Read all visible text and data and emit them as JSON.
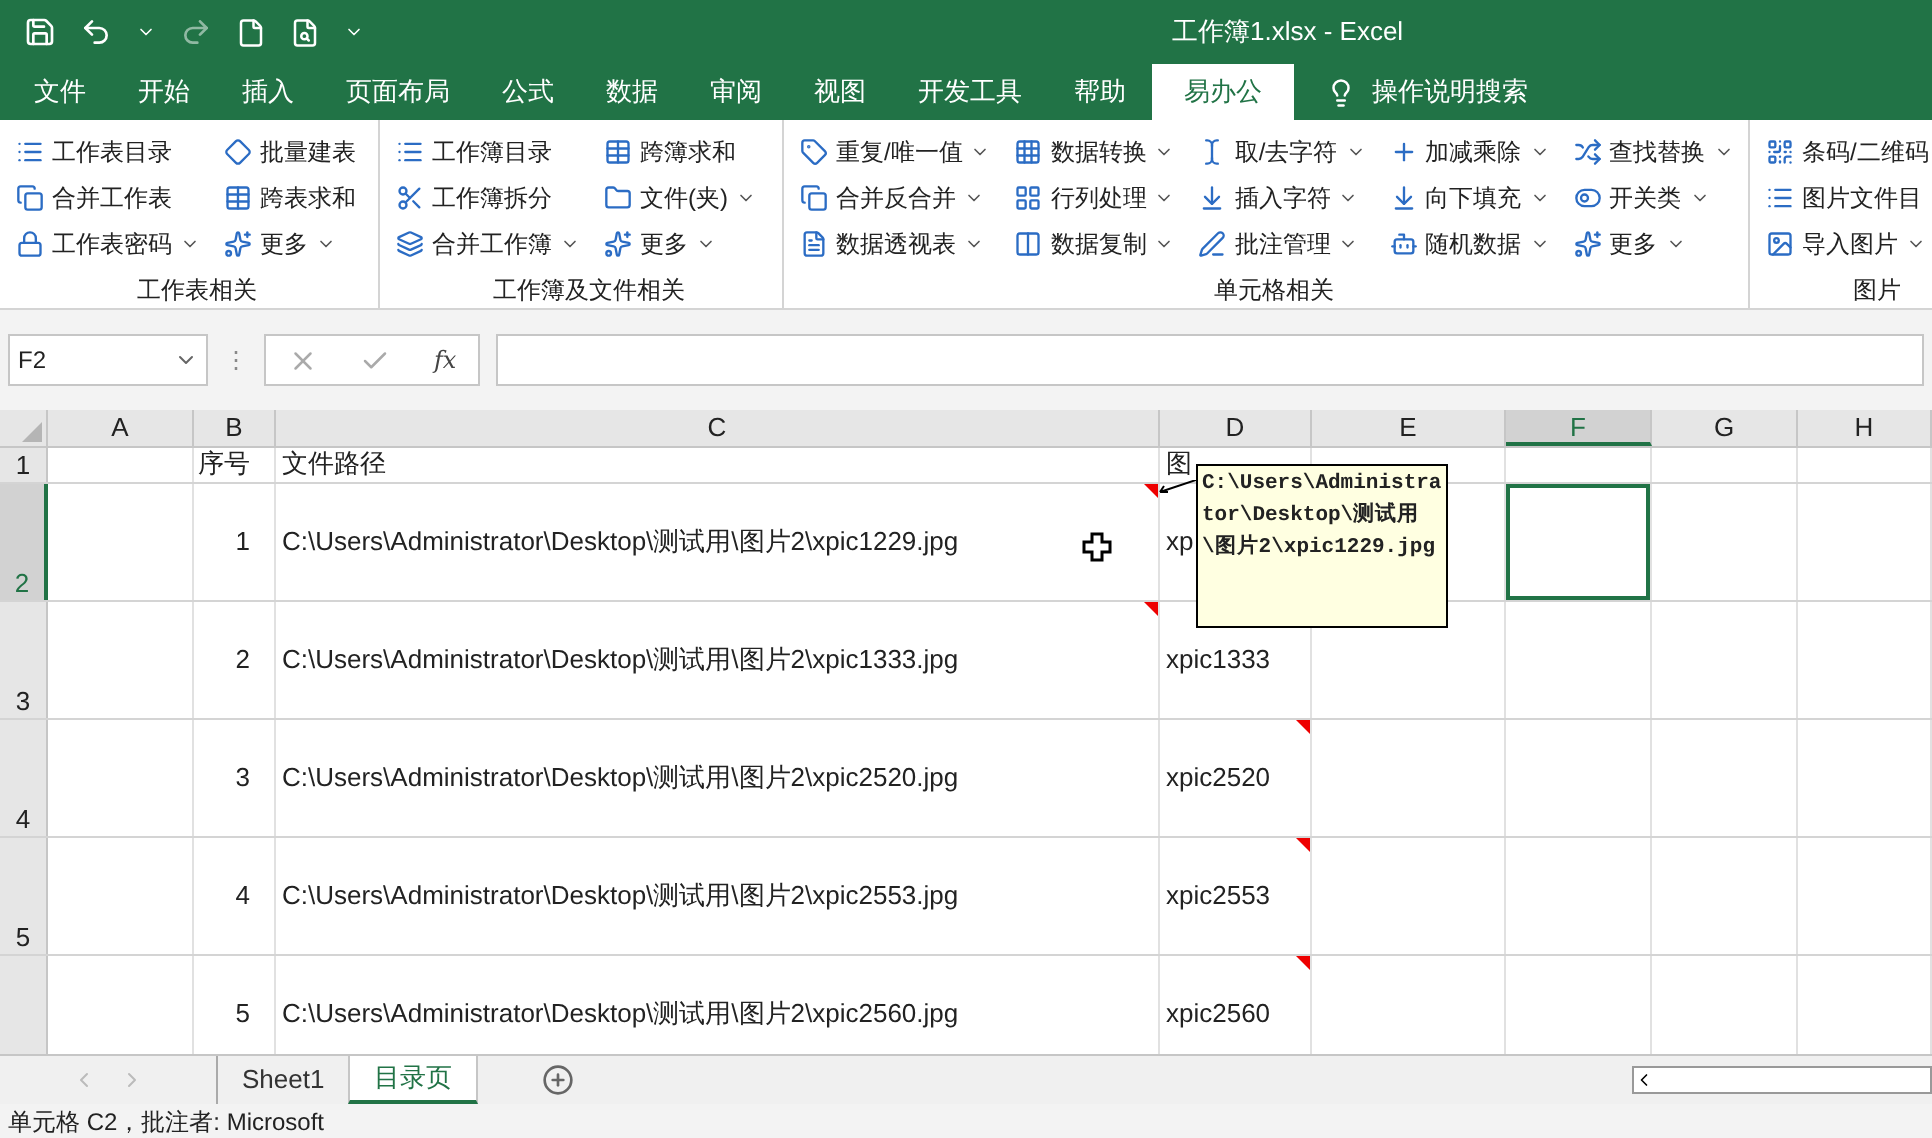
{
  "title_bar": {
    "title": "工作簿1.xlsx  -  Excel"
  },
  "menu_tabs": [
    {
      "label": "文件",
      "selected": false
    },
    {
      "label": "开始",
      "selected": false
    },
    {
      "label": "插入",
      "selected": false
    },
    {
      "label": "页面布局",
      "selected": false
    },
    {
      "label": "公式",
      "selected": false
    },
    {
      "label": "数据",
      "selected": false
    },
    {
      "label": "审阅",
      "selected": false
    },
    {
      "label": "视图",
      "selected": false
    },
    {
      "label": "开发工具",
      "selected": false
    },
    {
      "label": "帮助",
      "selected": false
    },
    {
      "label": "易办公",
      "selected": true
    }
  ],
  "tell_me": "操作说明搜索",
  "ribbon_groups": [
    {
      "label": "工作表相关",
      "columns": [
        [
          {
            "label": "工作表目录",
            "dropdown": false
          },
          {
            "label": "合并工作表",
            "dropdown": false
          },
          {
            "label": "工作表密码",
            "dropdown": true
          }
        ],
        [
          {
            "label": "批量建表",
            "dropdown": false
          },
          {
            "label": "跨表求和",
            "dropdown": false
          },
          {
            "label": "更多",
            "dropdown": true
          }
        ]
      ]
    },
    {
      "label": "工作簿及文件相关",
      "columns": [
        [
          {
            "label": "工作簿目录",
            "dropdown": false
          },
          {
            "label": "工作簿拆分",
            "dropdown": false
          },
          {
            "label": "合并工作簿",
            "dropdown": true
          }
        ],
        [
          {
            "label": "跨簿求和",
            "dropdown": false
          },
          {
            "label": "文件(夹)",
            "dropdown": true
          },
          {
            "label": "更多",
            "dropdown": true
          }
        ]
      ]
    },
    {
      "label": "单元格相关",
      "columns": [
        [
          {
            "label": "重复/唯一值",
            "dropdown": true
          },
          {
            "label": "合并反合并",
            "dropdown": true
          },
          {
            "label": "数据透视表",
            "dropdown": true
          }
        ],
        [
          {
            "label": "数据转换",
            "dropdown": true
          },
          {
            "label": "行列处理",
            "dropdown": true
          },
          {
            "label": "数据复制",
            "dropdown": true
          }
        ],
        [
          {
            "label": "取/去字符",
            "dropdown": true
          },
          {
            "label": "插入字符",
            "dropdown": true
          },
          {
            "label": "批注管理",
            "dropdown": true
          }
        ],
        [
          {
            "label": "加减乘除",
            "dropdown": true
          },
          {
            "label": "向下填充",
            "dropdown": true
          },
          {
            "label": "随机数据",
            "dropdown": true
          }
        ],
        [
          {
            "label": "查找替换",
            "dropdown": true
          },
          {
            "label": "开关类",
            "dropdown": true
          },
          {
            "label": "更多",
            "dropdown": true
          }
        ]
      ]
    },
    {
      "label": "图片",
      "columns": [
        [
          {
            "label": "条码/二维码"
          },
          {
            "label": "图片文件目"
          },
          {
            "label": "导入图片",
            "dropdown": true
          }
        ]
      ]
    }
  ],
  "formula_bar": {
    "name_box": "F2",
    "separator": "⋮",
    "fx": "fx"
  },
  "columns": [
    {
      "label": "A",
      "selected": false
    },
    {
      "label": "B",
      "selected": false
    },
    {
      "label": "C",
      "selected": false
    },
    {
      "label": "D",
      "selected": false
    },
    {
      "label": "E",
      "selected": false
    },
    {
      "label": "F",
      "selected": true
    },
    {
      "label": "G",
      "selected": false
    },
    {
      "label": "H",
      "selected": false
    }
  ],
  "header_row": {
    "number": "1",
    "selected": false,
    "cells": [
      "",
      "序号",
      "文件路径",
      "图",
      "",
      "",
      "",
      ""
    ]
  },
  "rows": [
    {
      "number": "2",
      "selected": true,
      "cells": [
        "",
        "1",
        "C:\\Users\\Administrator\\Desktop\\测试用\\图片2\\xpic1229.jpg",
        "xp",
        "",
        "",
        "",
        ""
      ],
      "path_comment": true,
      "image_comment": false
    },
    {
      "number": "3",
      "selected": false,
      "cells": [
        "",
        "2",
        "C:\\Users\\Administrator\\Desktop\\测试用\\图片2\\xpic1333.jpg",
        "xpic1333",
        "",
        "",
        "",
        ""
      ],
      "path_comment": true,
      "image_comment": false
    },
    {
      "number": "4",
      "selected": false,
      "cells": [
        "",
        "3",
        "C:\\Users\\Administrator\\Desktop\\测试用\\图片2\\xpic2520.jpg",
        "xpic2520",
        "",
        "",
        "",
        ""
      ],
      "path_comment": false,
      "image_comment": true
    },
    {
      "number": "5",
      "selected": false,
      "cells": [
        "",
        "4",
        "C:\\Users\\Administrator\\Desktop\\测试用\\图片2\\xpic2553.jpg",
        "xpic2553",
        "",
        "",
        "",
        ""
      ],
      "path_comment": false,
      "image_comment": true
    },
    {
      "selected": false,
      "cells": [
        "",
        "5",
        "C:\\Users\\Administrator\\Desktop\\测试用\\图片2\\xpic2560.jpg",
        "xpic2560",
        "",
        "",
        "",
        ""
      ],
      "path_comment": false,
      "image_comment": true
    }
  ],
  "comment": {
    "text": "C:\\Users\\Administrator\\Desktop\\测试用\\图片2\\xpic1229.jpg"
  },
  "sheet_tabs": [
    {
      "label": "Sheet1",
      "selected": false
    },
    {
      "label": "目录页",
      "selected": true
    }
  ],
  "status_bar": {
    "text": "单元格 C2，批注者: Microsoft"
  }
}
